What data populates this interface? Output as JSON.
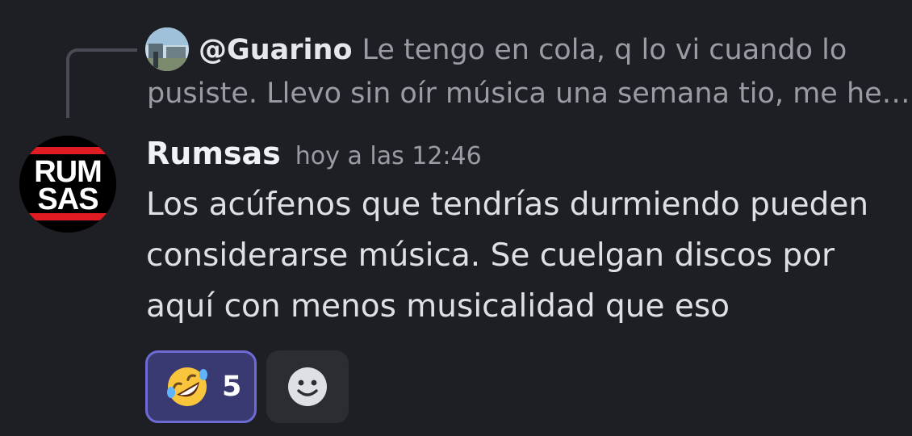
{
  "reply": {
    "author": "@Guarino",
    "text_line1": "Le tengo en cola, q lo vi cuando lo",
    "text_line2": "pusiste. Llevo sin oír música una semana tio, me he…"
  },
  "message": {
    "author": "Rumsas",
    "timestamp": "hoy a las 12:46",
    "avatar_text_top": "RUM",
    "avatar_text_bottom": "SAS",
    "lines": [
      "Los acúfenos que tendrías durmiendo pueden",
      "considerarse música. Se cuelgan discos por",
      "aquí con menos musicalidad que eso"
    ]
  },
  "reactions": [
    {
      "emoji": "rolling-on-floor-laughing-emoji",
      "count": "5"
    }
  ],
  "add_reaction_icon": "smiley-face-icon",
  "colors": {
    "background": "#1e1f24",
    "reaction_active_bg": "#393a72",
    "reaction_active_border": "#6d6ad4",
    "avatar_red": "#e11b22"
  }
}
